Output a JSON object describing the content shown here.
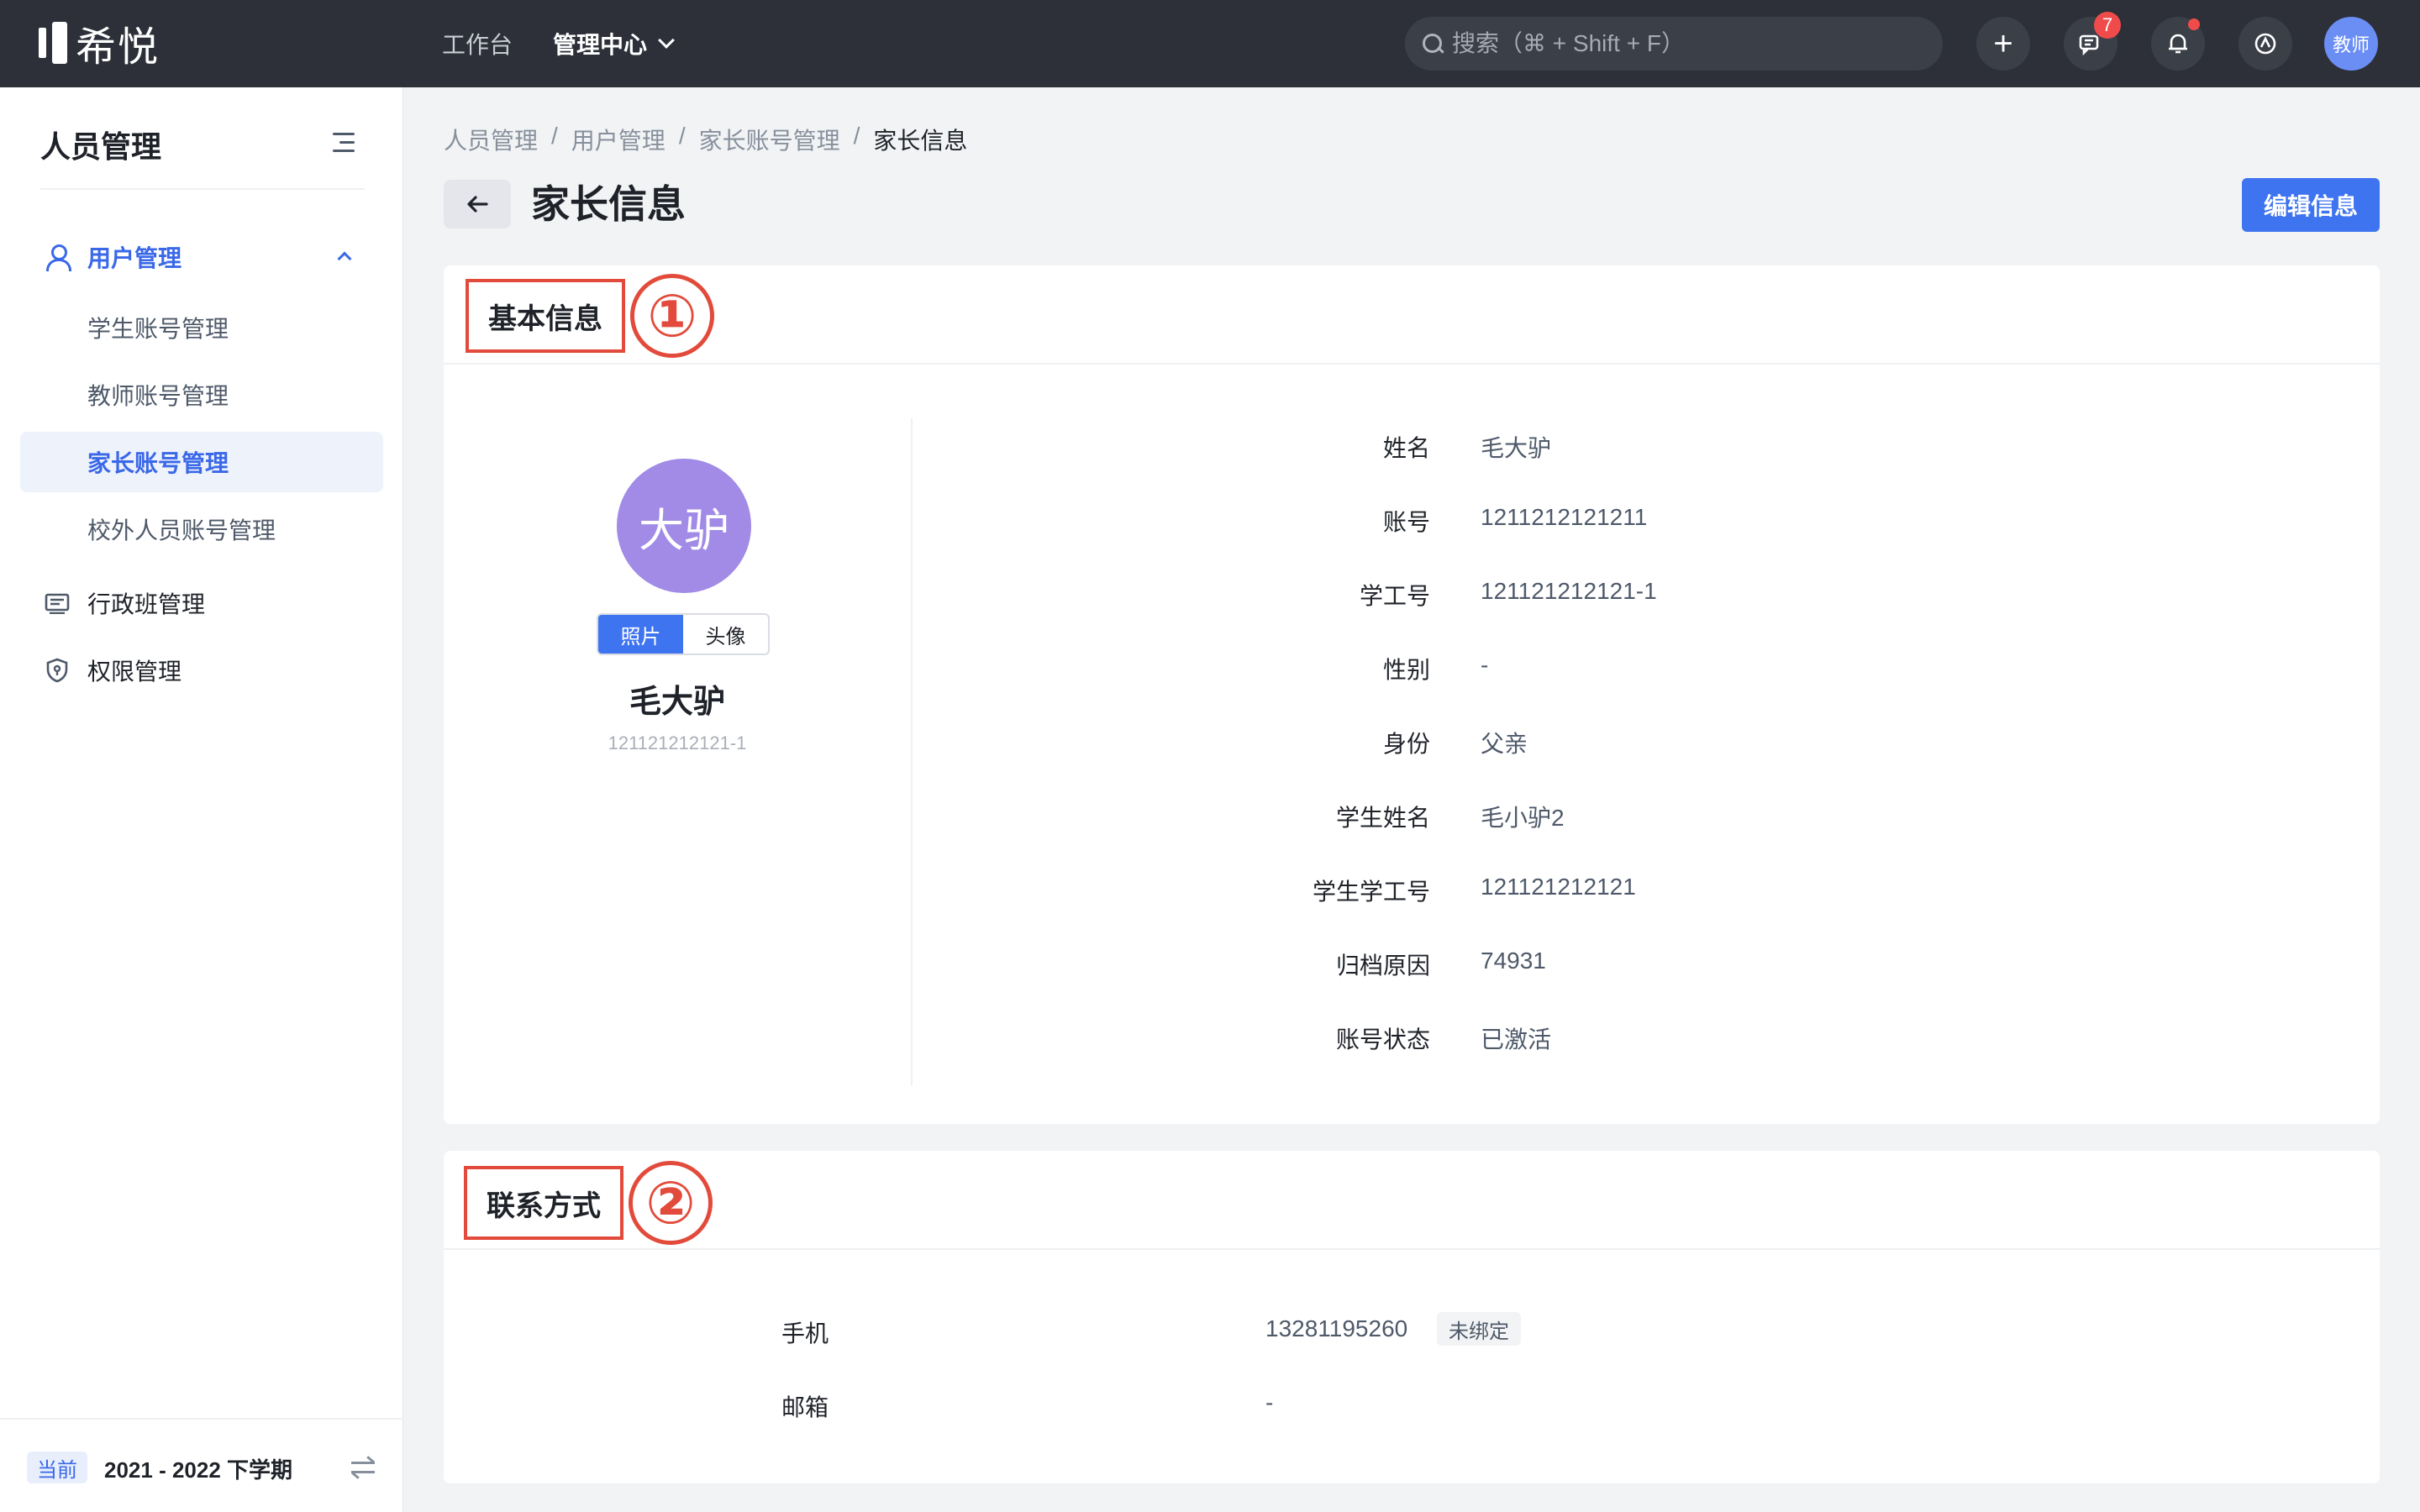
{
  "app": {
    "logo_text": "希悦",
    "nav": [
      "工作台",
      "管理中心"
    ],
    "search_placeholder": "搜索（⌘ + Shift + F）",
    "message_count": "7",
    "user_avatar_text": "教师"
  },
  "sidebar": {
    "title": "人员管理",
    "group_label": "用户管理",
    "sub_items": [
      "学生账号管理",
      "教师账号管理",
      "家长账号管理",
      "校外人员账号管理"
    ],
    "active_sub_index": 2,
    "items": [
      "行政班管理",
      "权限管理"
    ],
    "footer_tag": "当前",
    "footer_term": "2021 - 2022 下学期"
  },
  "breadcrumb": [
    "人员管理",
    "用户管理",
    "家长账号管理",
    "家长信息"
  ],
  "page": {
    "title": "家长信息",
    "edit_button": "编辑信息"
  },
  "basic_info": {
    "section_title": "基本信息",
    "annotation": "①",
    "avatar_text": "大驴",
    "toggle": [
      "照片",
      "头像"
    ],
    "name": "毛大驴",
    "id": "121121212121-1",
    "fields": [
      {
        "label": "姓名",
        "value": "毛大驴"
      },
      {
        "label": "账号",
        "value": "1211212121211"
      },
      {
        "label": "学工号",
        "value": "121121212121-1"
      },
      {
        "label": "性别",
        "value": "-"
      },
      {
        "label": "身份",
        "value": "父亲"
      },
      {
        "label": "学生姓名",
        "value": "毛小驴2"
      },
      {
        "label": "学生学工号",
        "value": "121121212121"
      },
      {
        "label": "归档原因",
        "value": "74931"
      },
      {
        "label": "账号状态",
        "value": "已激活"
      }
    ]
  },
  "contact": {
    "section_title": "联系方式",
    "annotation": "②",
    "phone_label": "手机",
    "phone_value": "13281195260",
    "phone_tag": "未绑定",
    "email_label": "邮箱",
    "email_value": "-"
  },
  "colors": {
    "accent": "#3f74f0",
    "annotation_red": "#e24b3b",
    "topbar": "#2d3038",
    "avatar_purple": "#a18be6"
  }
}
